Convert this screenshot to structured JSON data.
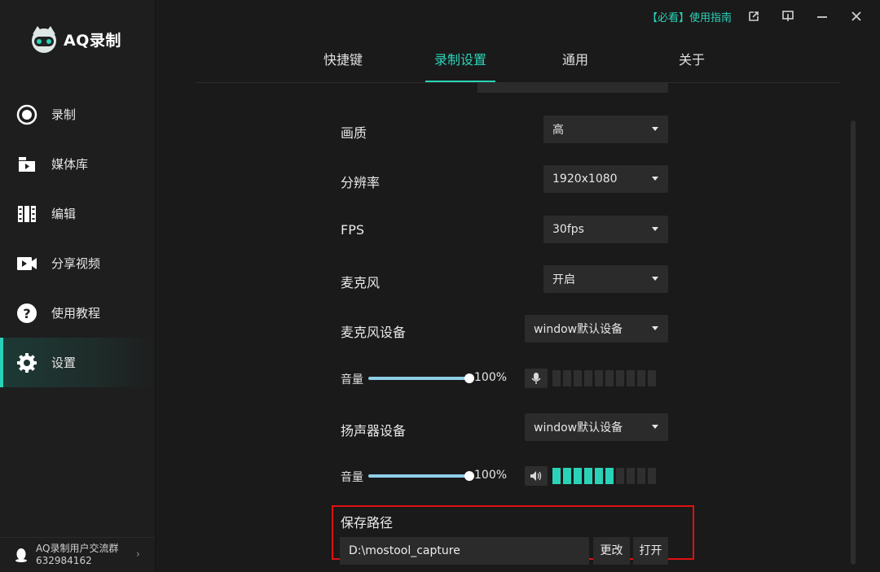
{
  "app": {
    "name": "AQ录制"
  },
  "titlebar": {
    "guide": "【必看】使用指南"
  },
  "sidebar": {
    "items": [
      {
        "label": "录制",
        "icon": "record-icon"
      },
      {
        "label": "媒体库",
        "icon": "media-library-icon"
      },
      {
        "label": "编辑",
        "icon": "edit-film-icon"
      },
      {
        "label": "分享视频",
        "icon": "share-video-icon"
      },
      {
        "label": "使用教程",
        "icon": "help-icon"
      },
      {
        "label": "设置",
        "icon": "gear-icon",
        "active": true
      }
    ],
    "community": {
      "line1": "AQ录制用户交流群",
      "line2": "632984162"
    }
  },
  "tabs": [
    {
      "label": "快捷键"
    },
    {
      "label": "录制设置",
      "active": true
    },
    {
      "label": "通用"
    },
    {
      "label": "关于"
    }
  ],
  "settings": {
    "quality": {
      "label": "画质",
      "value": "高"
    },
    "resolution": {
      "label": "分辨率",
      "value": "1920x1080"
    },
    "fps": {
      "label": "FPS",
      "value": "30fps"
    },
    "mic": {
      "label": "麦克风",
      "value": "开启"
    },
    "mic_device": {
      "label": "麦克风设备",
      "value": "window默认设备"
    },
    "mic_volume": {
      "label": "音量",
      "percent": "100%",
      "level": 1.0,
      "meter_on": 0,
      "meter_total": 10
    },
    "speaker_device": {
      "label": "扬声器设备",
      "value": "window默认设备"
    },
    "speaker_volume": {
      "label": "音量",
      "percent": "100%",
      "level": 1.0,
      "meter_on": 6,
      "meter_total": 10
    },
    "save_path": {
      "label": "保存路径",
      "value": "D:\\mostool_capture",
      "change": "更改",
      "open": "打开"
    }
  },
  "colors": {
    "accent": "#2ad3b8",
    "highlight": "#e01010",
    "slider": "#8ecfe8"
  }
}
